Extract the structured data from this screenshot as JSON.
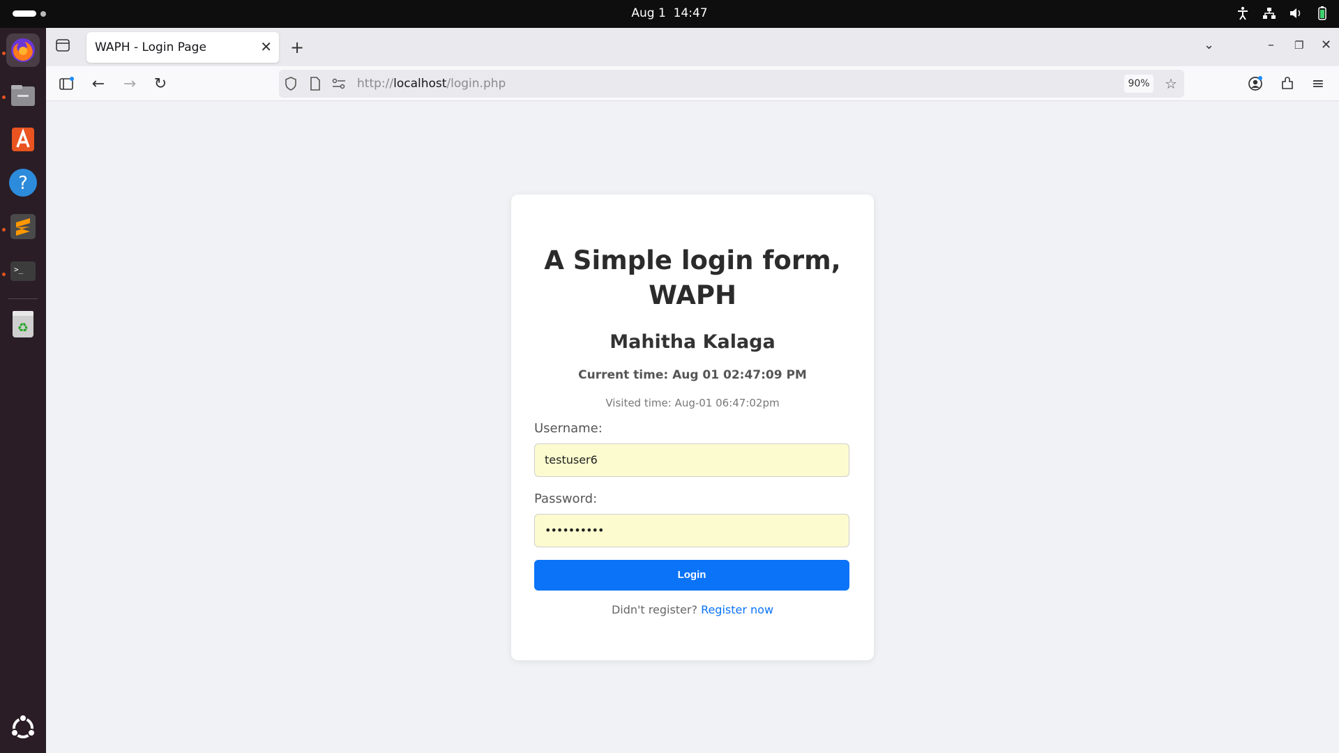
{
  "system": {
    "clock_date": "Aug 1",
    "clock_time": "14:47"
  },
  "dock": {
    "apps": [
      "firefox-icon",
      "files-icon",
      "app-center-icon",
      "help-icon",
      "sublime-text-icon",
      "terminal-icon",
      "trash-icon",
      "ubuntu-apps-icon"
    ]
  },
  "browser": {
    "tab_title": "WAPH - Login Page",
    "url_scheme": "http://",
    "url_host": "localhost",
    "url_path": "/login.php",
    "zoom": "90%"
  },
  "page": {
    "title": "A Simple login form, WAPH",
    "author": "Mahitha Kalaga",
    "current_time": "Current time: Aug 01 02:47:09 PM",
    "visited_time": "Visited time: Aug-01 06:47:02pm",
    "username_label": "Username:",
    "username_value": "testuser6",
    "password_label": "Password:",
    "password_value": "••••••••••",
    "login_label": "Login",
    "register_prompt": "Didn't register?",
    "register_link": "Register now"
  }
}
